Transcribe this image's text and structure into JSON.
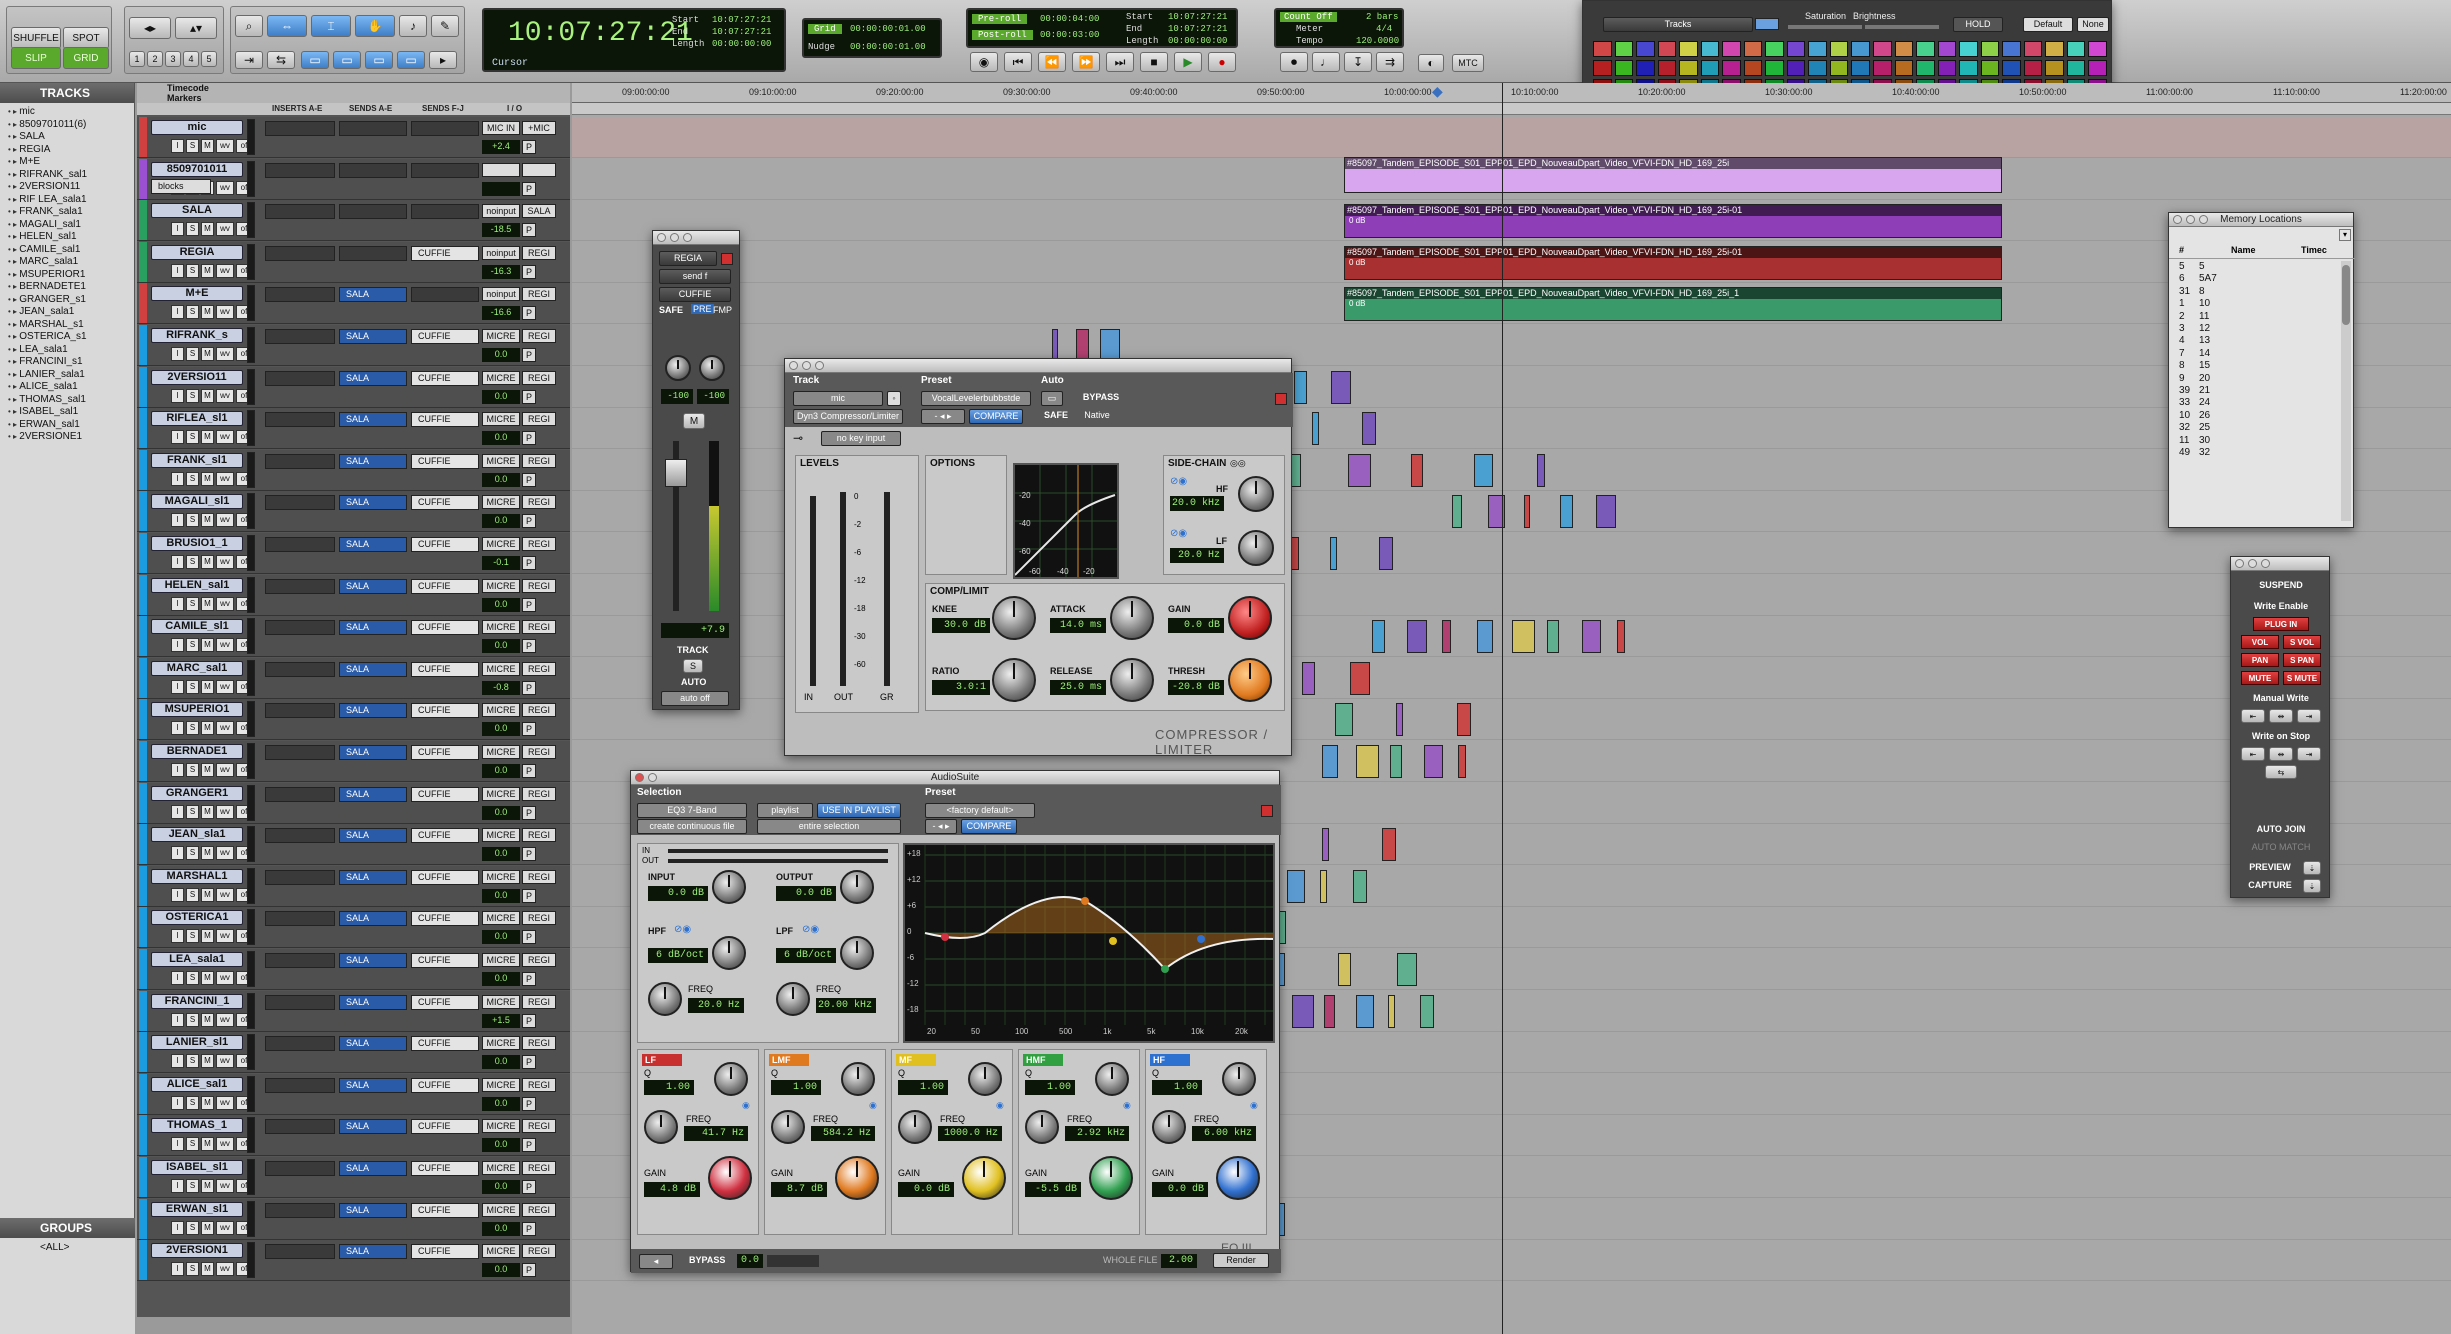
{
  "toolbar": {
    "edit_modes": [
      "SHUFFLE",
      "SPOT",
      "SLIP",
      "GRID"
    ],
    "zoom_presets": [
      "1",
      "2",
      "3",
      "4",
      "5"
    ],
    "main_counter": "10:07:27:21",
    "counter_mode": "Cursor",
    "start_label": "Start",
    "end_label": "End",
    "length_label": "Length",
    "start_value": "10:07:27:21",
    "end_value": "10:07:27:21",
    "length_value": "00:00:00:00",
    "grid_label": "Grid",
    "grid_value": "00:00:00:01.00",
    "nudge_label": "Nudge",
    "nudge_value": "00:00:00:01.00",
    "preroll_label": "Pre-roll",
    "preroll_value": "00:00:04:00",
    "postroll_label": "Post-roll",
    "postroll_value": "00:00:03:00",
    "start2_value": "10:07:27:21",
    "end2_value": "10:07:27:21",
    "length2_value": "00:00:00:00",
    "countoff_label": "Count Off",
    "countoff_value": "2 bars",
    "meter_label": "Meter",
    "meter_value": "4/4",
    "tempo_label": "Tempo",
    "tempo_value": "120.0000",
    "mtc_label": "MTC"
  },
  "color_palette": {
    "target_label": "Tracks",
    "saturation_label": "Saturation",
    "brightness_label": "Brightness",
    "hold_label": "HOLD",
    "default_label": "Default",
    "none_label": "None"
  },
  "left_panel": {
    "tracks_header": "TRACKS",
    "tracks": [
      "mic",
      "8509701011(6)",
      "SALA",
      "REGIA",
      "M+E",
      "RIFRANK_sal1",
      "2VERSION11",
      "RIF LEA_sala1",
      "FRANK_sala1",
      "MAGALI_sal1",
      "HELEN_sal1",
      "CAMILE_sal1",
      "MARC_sala1",
      "MSUPERIOR1",
      "BERNADETE1",
      "GRANGER_s1",
      "JEAN_sala1",
      "MARSHAL_s1",
      "OSTERICA_s1",
      "LEA_sala1",
      "FRANCINI_s1",
      "LANIER_sala1",
      "ALICE_sala1",
      "THOMAS_sal1",
      "ISABEL_sal1",
      "ERWAN_sal1",
      "2VERSIONE1"
    ],
    "groups_header": "GROUPS",
    "groups": [
      "<ALL>"
    ]
  },
  "edit_header": {
    "timecode_label": "Timecode",
    "markers_label": "Markers",
    "inserts_label": "INSERTS A-E",
    "sends_ae_label": "SENDS A-E",
    "sends_fj_label": "SENDS F-J",
    "io_label": "I / O"
  },
  "tracks": [
    {
      "name": "mic",
      "color": "#d04040",
      "send1": "",
      "send2": "",
      "io": "MIC IN",
      "io2": "+MIC",
      "vol": "+2.4"
    },
    {
      "name": "8509701011",
      "color": "#9a50d0",
      "send1": "",
      "send2": "",
      "io": "",
      "io2": "",
      "vol": "",
      "extra": "blocks"
    },
    {
      "name": "SALA",
      "color": "#2aa060",
      "send1": "",
      "send2": "",
      "io": "noinput",
      "io2": "SALA",
      "vol": "-18.5"
    },
    {
      "name": "REGIA",
      "color": "#2aa060",
      "send1": "",
      "send2": "CUFFIE",
      "io": "noinput",
      "io2": "REGI",
      "vol": "-16.3"
    },
    {
      "name": "M+E",
      "color": "#d04040",
      "send1": "SALA",
      "send2": "",
      "io": "noinput",
      "io2": "REGI",
      "vol": "-16.6"
    },
    {
      "name": "RIFRANK_s",
      "color": "#1c9ce0",
      "send1": "SALA",
      "send2": "CUFFIE",
      "io": "MICRE",
      "io2": "REGI",
      "vol": "0.0"
    },
    {
      "name": "2VERSIO11",
      "color": "#1c9ce0",
      "send1": "SALA",
      "send2": "CUFFIE",
      "io": "MICRE",
      "io2": "REGI",
      "vol": "0.0"
    },
    {
      "name": "RIFLEA_sl1",
      "color": "#1c9ce0",
      "send1": "SALA",
      "send2": "CUFFIE",
      "io": "MICRE",
      "io2": "REGI",
      "vol": "0.0"
    },
    {
      "name": "FRANK_sl1",
      "color": "#1c9ce0",
      "send1": "SALA",
      "send2": "CUFFIE",
      "io": "MICRE",
      "io2": "REGI",
      "vol": "0.0"
    },
    {
      "name": "MAGALI_sl1",
      "color": "#1c9ce0",
      "send1": "SALA",
      "send2": "CUFFIE",
      "io": "MICRE",
      "io2": "REGI",
      "vol": "0.0"
    },
    {
      "name": "BRUSIO1_1",
      "color": "#1c9ce0",
      "send1": "SALA",
      "send2": "CUFFIE",
      "io": "MICRE",
      "io2": "REGI",
      "vol": "-0.1"
    },
    {
      "name": "HELEN_sal1",
      "color": "#1c9ce0",
      "send1": "SALA",
      "send2": "CUFFIE",
      "io": "MICRE",
      "io2": "REGI",
      "vol": "0.0"
    },
    {
      "name": "CAMILE_sl1",
      "color": "#1c9ce0",
      "send1": "SALA",
      "send2": "CUFFIE",
      "io": "MICRE",
      "io2": "REGI",
      "vol": "0.0"
    },
    {
      "name": "MARC_sal1",
      "color": "#1c9ce0",
      "send1": "SALA",
      "send2": "CUFFIE",
      "io": "MICRE",
      "io2": "REGI",
      "vol": "-0.8"
    },
    {
      "name": "MSUPERIO1",
      "color": "#1c9ce0",
      "send1": "SALA",
      "send2": "CUFFIE",
      "io": "MICRE",
      "io2": "REGI",
      "vol": "0.0"
    },
    {
      "name": "BERNADE1",
      "color": "#1c9ce0",
      "send1": "SALA",
      "send2": "CUFFIE",
      "io": "MICRE",
      "io2": "REGI",
      "vol": "0.0"
    },
    {
      "name": "GRANGER1",
      "color": "#1c9ce0",
      "send1": "SALA",
      "send2": "CUFFIE",
      "io": "MICRE",
      "io2": "REGI",
      "vol": "0.0"
    },
    {
      "name": "JEAN_sla1",
      "color": "#1c9ce0",
      "send1": "SALA",
      "send2": "CUFFIE",
      "io": "MICRE",
      "io2": "REGI",
      "vol": "0.0"
    },
    {
      "name": "MARSHAL1",
      "color": "#1c9ce0",
      "send1": "SALA",
      "send2": "CUFFIE",
      "io": "MICRE",
      "io2": "REGI",
      "vol": "0.0"
    },
    {
      "name": "OSTERICA1",
      "color": "#1c9ce0",
      "send1": "SALA",
      "send2": "CUFFIE",
      "io": "MICRE",
      "io2": "REGI",
      "vol": "0.0"
    },
    {
      "name": "LEA_sala1",
      "color": "#1c9ce0",
      "send1": "SALA",
      "send2": "CUFFIE",
      "io": "MICRE",
      "io2": "REGI",
      "vol": "0.0"
    },
    {
      "name": "FRANCINI_1",
      "color": "#1c9ce0",
      "send1": "SALA",
      "send2": "CUFFIE",
      "io": "MICRE",
      "io2": "REGI",
      "vol": "+1.5"
    },
    {
      "name": "LANIER_sl1",
      "color": "#1c9ce0",
      "send1": "SALA",
      "send2": "CUFFIE",
      "io": "MICRE",
      "io2": "REGI",
      "vol": "0.0"
    },
    {
      "name": "ALICE_sal1",
      "color": "#1c9ce0",
      "send1": "SALA",
      "send2": "CUFFIE",
      "io": "MICRE",
      "io2": "REGI",
      "vol": "0.0"
    },
    {
      "name": "THOMAS_1",
      "color": "#1c9ce0",
      "send1": "SALA",
      "send2": "CUFFIE",
      "io": "MICRE",
      "io2": "REGI",
      "vol": "0.0"
    },
    {
      "name": "ISABEL_sl1",
      "color": "#1c9ce0",
      "send1": "SALA",
      "send2": "CUFFIE",
      "io": "MICRE",
      "io2": "REGI",
      "vol": "0.0"
    },
    {
      "name": "ERWAN_sl1",
      "color": "#1c9ce0",
      "send1": "SALA",
      "send2": "CUFFIE",
      "io": "MICRE",
      "io2": "REGI",
      "vol": "0.0"
    },
    {
      "name": "2VERSION1",
      "color": "#1c9ce0",
      "send1": "SALA",
      "send2": "CUFFIE",
      "io": "MICRE",
      "io2": "REGI",
      "vol": "0.0"
    }
  ],
  "ruler_ticks": [
    "09:00:00:00",
    "09:10:00:00",
    "09:20:00:00",
    "09:30:00:00",
    "09:40:00:00",
    "09:50:00:00",
    "10:00:00:00",
    "10:10:00:00",
    "10:20:00:00",
    "10:30:00:00",
    "10:40:00:00",
    "10:50:00:00",
    "11:00:00:00",
    "11:10:00:00",
    "11:20:00:00"
  ],
  "video_clips": [
    {
      "name": "#85097_Tandem_EPISODE_S01_EPP01_EPD_NouveauDpart_Video_VFVI-FDN_HD_169_25i",
      "color": "#d7a6ee"
    },
    {
      "name": "#85097_Tandem_EPISODE_S01_EPP01_EPD_NouveauDpart_Video_VFVI-FDN_HD_169_25i-01",
      "color": "#8e3fb8"
    },
    {
      "name": "#85097_Tandem_EPISODE_S01_EPP01_EPD_NouveauDpart_Video_VFVI-FDN_HD_169_25i-01",
      "color": "#a83030"
    },
    {
      "name": "#85097_Tandem_EPISODE_S01_EPP01_EPD_NouveauDpart_Video_VFVI-FDN_HD_169_25i_1",
      "color": "#3a9a6a"
    }
  ],
  "clip_gain": "0 dB",
  "mix_strip": {
    "name": "REGIA",
    "send": "send f",
    "output": "CUFFIE",
    "safe": "SAFE",
    "pre": "PRE",
    "fmp": "FMP",
    "pan_left": "-100",
    "pan_right": "-100",
    "mute": "M",
    "volume": "+7.9",
    "track_label": "TRACK",
    "solo": "S",
    "auto_label": "AUTO",
    "auto_mode": "auto off"
  },
  "compressor": {
    "title": "",
    "track_label": "Track",
    "preset_label": "Preset",
    "auto_label": "Auto",
    "track": "mic",
    "preset": "VocalLevelerbubbstde",
    "plugin": "Dyn3 Compressor/Limiter",
    "compare": "COMPARE",
    "bypass": "BYPASS",
    "safe": "SAFE",
    "native": "Native",
    "key_input": "no key input",
    "levels": "LEVELS",
    "options": "OPTIONS",
    "sidechain": "SIDE-CHAIN",
    "meter_labels": [
      "IN",
      "OUT",
      "GR"
    ],
    "scale": [
      "0",
      "-2",
      "-6",
      "-12",
      "-18",
      "-30",
      "-60"
    ],
    "hf_label": "HF",
    "hf_value": "20.0 kHz",
    "lf_label": "LF",
    "lf_value": "20.0 Hz",
    "section": "COMP/LIMIT",
    "knee_label": "KNEE",
    "knee_value": "30.0 dB",
    "attack_label": "ATTACK",
    "attack_value": "14.0 ms",
    "gain_label": "GAIN",
    "gain_value": "0.0 dB",
    "ratio_label": "RATIO",
    "ratio_value": "3.0:1",
    "release_label": "RELEASE",
    "release_value": "25.0 ms",
    "thresh_label": "THRESH",
    "thresh_value": "-20.8 dB",
    "brand": "COMPRESSOR / LIMITER",
    "graph_y": [
      "-20",
      "-40",
      "-60"
    ],
    "graph_x": [
      "-60",
      "-40",
      "-20"
    ]
  },
  "audiosuite": {
    "title": "AudioSuite",
    "selection_label": "Selection",
    "preset_label": "Preset",
    "plugin": "EQ3 7-Band",
    "playlist": "playlist",
    "use_in_playlist": "USE IN PLAYLIST",
    "preset": "<factory default>",
    "continuous": "create continuous file",
    "entire": "entire selection",
    "compare": "COMPARE",
    "in_label": "IN",
    "out_label": "OUT",
    "input_label": "INPUT",
    "input_value": "0.0 dB",
    "output_label": "OUTPUT",
    "output_value": "0.0 dB",
    "hpf_label": "HPF",
    "hpf_q": "6 dB/oct",
    "hpf_freq_label": "FREQ",
    "hpf_freq": "20.0 Hz",
    "lpf_label": "LPF",
    "lpf_q": "6 dB/oct",
    "lpf_freq_label": "FREQ",
    "lpf_freq": "20.00 kHz",
    "bands": [
      {
        "name": "LF",
        "color": "#c83030",
        "q": "1.00",
        "freq": "41.7 Hz",
        "gain": "4.8 dB",
        "knob": "#d03040"
      },
      {
        "name": "LMF",
        "color": "#e07a20",
        "q": "1.00",
        "freq": "584.2 Hz",
        "gain": "8.7 dB",
        "knob": "#e07a20"
      },
      {
        "name": "MF",
        "color": "#e0c020",
        "q": "1.00",
        "freq": "1000.0 Hz",
        "gain": "0.0 dB",
        "knob": "#e0c020"
      },
      {
        "name": "HMF",
        "color": "#30a040",
        "q": "1.00",
        "freq": "2.92 kHz",
        "gain": "-5.5 dB",
        "knob": "#30a050"
      },
      {
        "name": "HF",
        "color": "#2c70d0",
        "q": "1.00",
        "freq": "6.00 kHz",
        "gain": "0.0 dB",
        "knob": "#3070d0"
      }
    ],
    "q_label": "Q",
    "freq_label": "FREQ",
    "gain_label": "GAIN",
    "graph_y": [
      "+18",
      "+12",
      "+6",
      "0",
      "-6",
      "-12",
      "-18"
    ],
    "graph_x": [
      "20",
      "50",
      "100",
      "500",
      "1k",
      "5k",
      "10k",
      "20k"
    ],
    "brand": "EQ III",
    "bypass": "BYPASS",
    "bypass_value": "0.0",
    "whole_file": "WHOLE FILE",
    "handle_value": "2.00",
    "render": "Render"
  },
  "memory_locations": {
    "title": "Memory Locations",
    "col_num": "#",
    "col_name": "Name",
    "col_time": "Timec",
    "rows": [
      [
        "5",
        "5"
      ],
      [
        "6",
        "5A7"
      ],
      [
        "31",
        "8"
      ],
      [
        "1",
        "10"
      ],
      [
        "2",
        "11"
      ],
      [
        "3",
        "12"
      ],
      [
        "4",
        "13"
      ],
      [
        "7",
        "14"
      ],
      [
        "8",
        "15"
      ],
      [
        "9",
        "20"
      ],
      [
        "39",
        "21"
      ],
      [
        "33",
        "24"
      ],
      [
        "10",
        "26"
      ],
      [
        "32",
        "25"
      ],
      [
        "11",
        "30"
      ],
      [
        "49",
        "32"
      ]
    ]
  },
  "automation": {
    "suspend": "SUSPEND",
    "write_enable": "Write Enable",
    "plug_in": "PLUG IN",
    "vol": "VOL",
    "s_vol": "S VOL",
    "pan": "PAN",
    "s_pan": "S PAN",
    "mute": "MUTE",
    "s_mute": "S MUTE",
    "manual_write": "Manual Write",
    "write_on_stop": "Write on Stop",
    "auto_join": "AUTO JOIN",
    "auto_match": "AUTO MATCH",
    "preview": "PREVIEW",
    "capture": "CAPTURE"
  }
}
